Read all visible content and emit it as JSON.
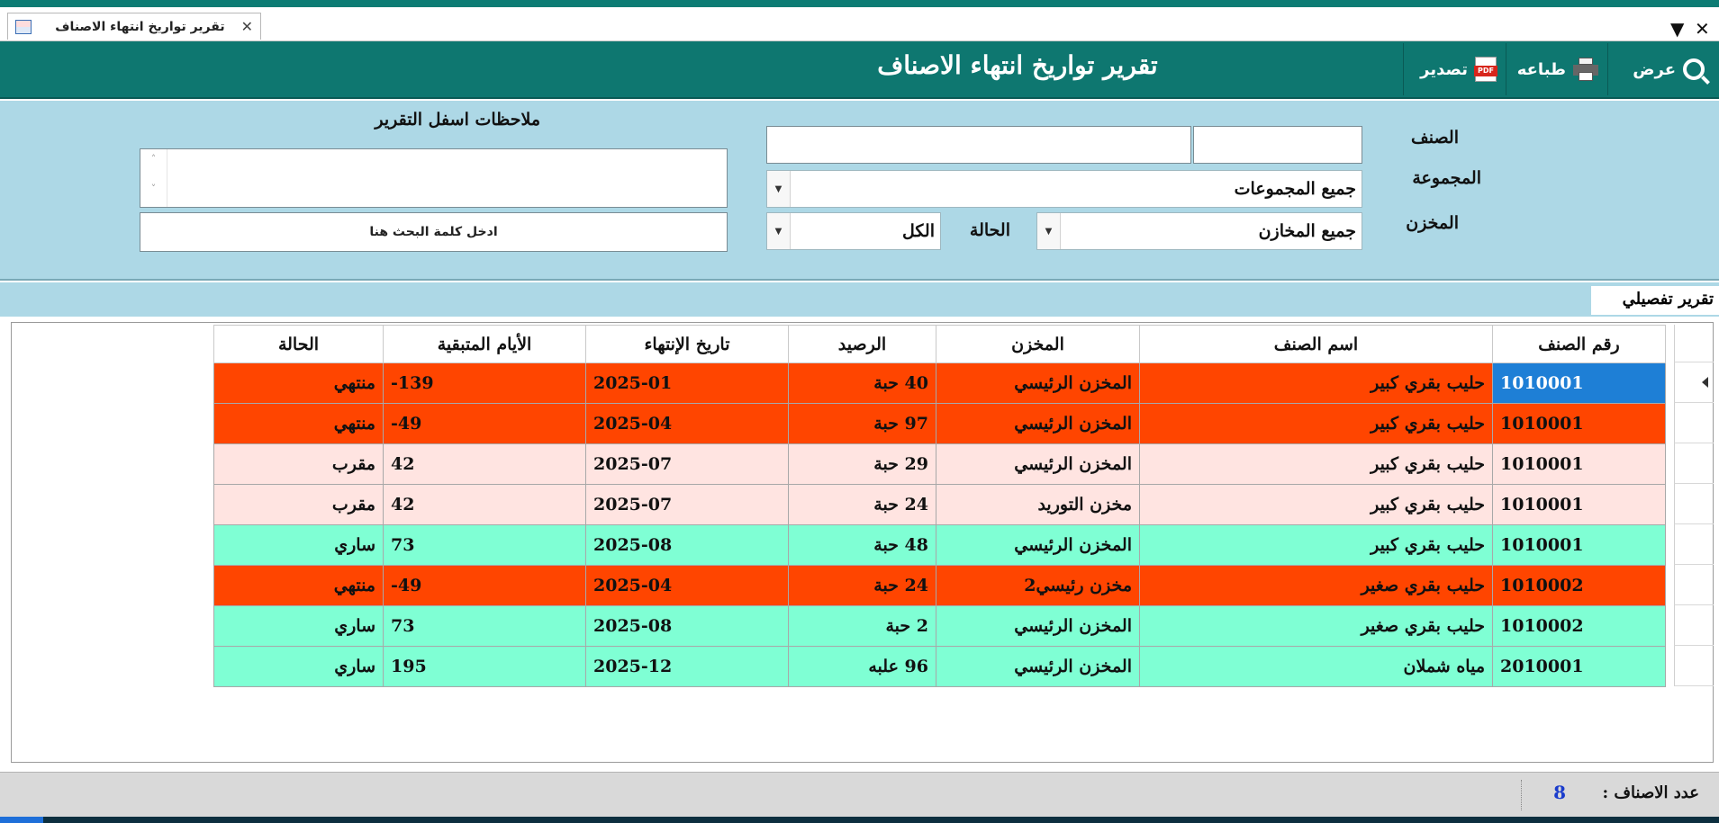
{
  "colors": {
    "accent": "#0e7770",
    "panel": "#add8e6",
    "expired": "#ff4500",
    "near": "#ffe4e1",
    "valid": "#7fffd4",
    "selected_cell": "#1e7fd6",
    "count": "#1a3ccc"
  },
  "tab": {
    "label": "تقرير تواريخ انتهاء الاصناف",
    "close": "✕",
    "icon": "form-icon"
  },
  "strip_controls": {
    "pin": "▼",
    "close": "✕"
  },
  "header": {
    "title": "تقرير تواريخ انتهاء الاصناف",
    "view_label": "عرض",
    "print_label": "طباعه",
    "export_label": "تصدير",
    "pdf_badge": "PDF"
  },
  "filters": {
    "item_label": "الصنف",
    "group_label": "المجموعة",
    "store_label": "المخزن",
    "status_label": "الحالة",
    "item_code_value": "",
    "item_name_value": "",
    "group_value": "جميع المجموعات",
    "store_value": "جميع المخازن",
    "status_value": "الكل",
    "notes_label": "ملاحظات اسفل التقرير",
    "notes_value": "",
    "search_text": "ادخل كلمة البحث هنا"
  },
  "detail": {
    "title": "تقرير تفصيلي"
  },
  "grid": {
    "columns": [
      "رقم الصنف",
      "اسم الصنف",
      "المخزن",
      "الرصيد",
      "تاريخ الإنتهاء",
      "الأيام المتبقية",
      "الحالة"
    ],
    "rows": [
      {
        "code": "1010001",
        "name": "حليب بقري كبير",
        "store": "المخزن الرئيسي",
        "balance": "40  حبة",
        "expiry": "2025-01",
        "days": "139-",
        "status": "منتهي",
        "state": "expired"
      },
      {
        "code": "1010001",
        "name": "حليب بقري كبير",
        "store": "المخزن الرئيسي",
        "balance": "97  حبة",
        "expiry": "2025-04",
        "days": "49-",
        "status": "منتهي",
        "state": "expired"
      },
      {
        "code": "1010001",
        "name": "حليب بقري كبير",
        "store": "المخزن الرئيسي",
        "balance": "29  حبة",
        "expiry": "2025-07",
        "days": "42",
        "status": "مقرب",
        "state": "near"
      },
      {
        "code": "1010001",
        "name": "حليب بقري كبير",
        "store": "مخزن التوريد",
        "balance": "24  حبة",
        "expiry": "2025-07",
        "days": "42",
        "status": "مقرب",
        "state": "near"
      },
      {
        "code": "1010001",
        "name": "حليب بقري كبير",
        "store": "المخزن الرئيسي",
        "balance": "48  حبة",
        "expiry": "2025-08",
        "days": "73",
        "status": "ساري",
        "state": "valid"
      },
      {
        "code": "1010002",
        "name": "حليب بقري صغير",
        "store": "مخزن رئيسي2",
        "balance": "24  حبة",
        "expiry": "2025-04",
        "days": "49-",
        "status": "منتهي",
        "state": "expired"
      },
      {
        "code": "1010002",
        "name": "حليب بقري صغير",
        "store": "المخزن الرئيسي",
        "balance": "2  حبة",
        "expiry": "2025-08",
        "days": "73",
        "status": "ساري",
        "state": "valid"
      },
      {
        "code": "2010001",
        "name": "مياه شملان",
        "store": "المخزن الرئيسي",
        "balance": "96  علبه",
        "expiry": "2025-12",
        "days": "195",
        "status": "ساري",
        "state": "valid"
      }
    ]
  },
  "status_bar": {
    "count_label": "عدد الاصناف :",
    "count_value": "8"
  }
}
